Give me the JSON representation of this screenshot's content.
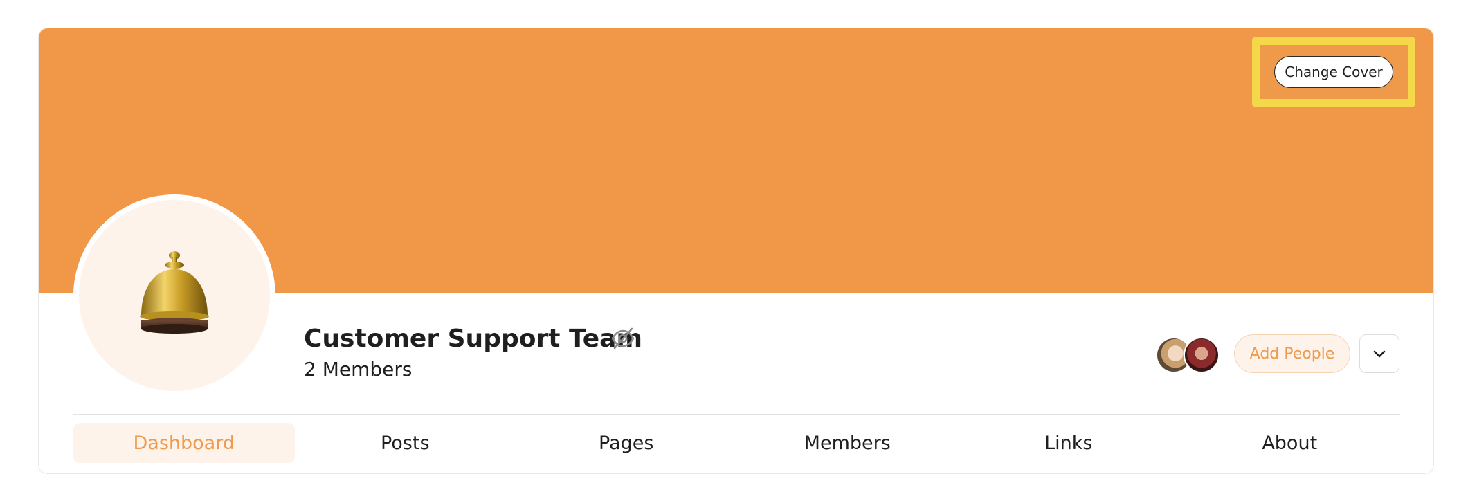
{
  "cover": {
    "color": "#f19848",
    "change_label": "Change Cover",
    "highlight_color": "#f5d84a"
  },
  "group": {
    "avatar_icon": "service-bell-icon",
    "title": "Customer Support Team",
    "visibility_icon": "eye-off-icon",
    "members_label": "2 Members"
  },
  "actions": {
    "member_avatars": [
      "member-avatar-1",
      "member-avatar-2"
    ],
    "add_people_label": "Add People",
    "more_icon": "chevron-down-icon"
  },
  "tabs": [
    {
      "label": "Dashboard",
      "active": true
    },
    {
      "label": "Posts",
      "active": false
    },
    {
      "label": "Pages",
      "active": false
    },
    {
      "label": "Members",
      "active": false
    },
    {
      "label": "Links",
      "active": false
    },
    {
      "label": "About",
      "active": false
    }
  ],
  "colors": {
    "accent": "#ef9a4c",
    "accent_soft": "#fdf3ea"
  }
}
